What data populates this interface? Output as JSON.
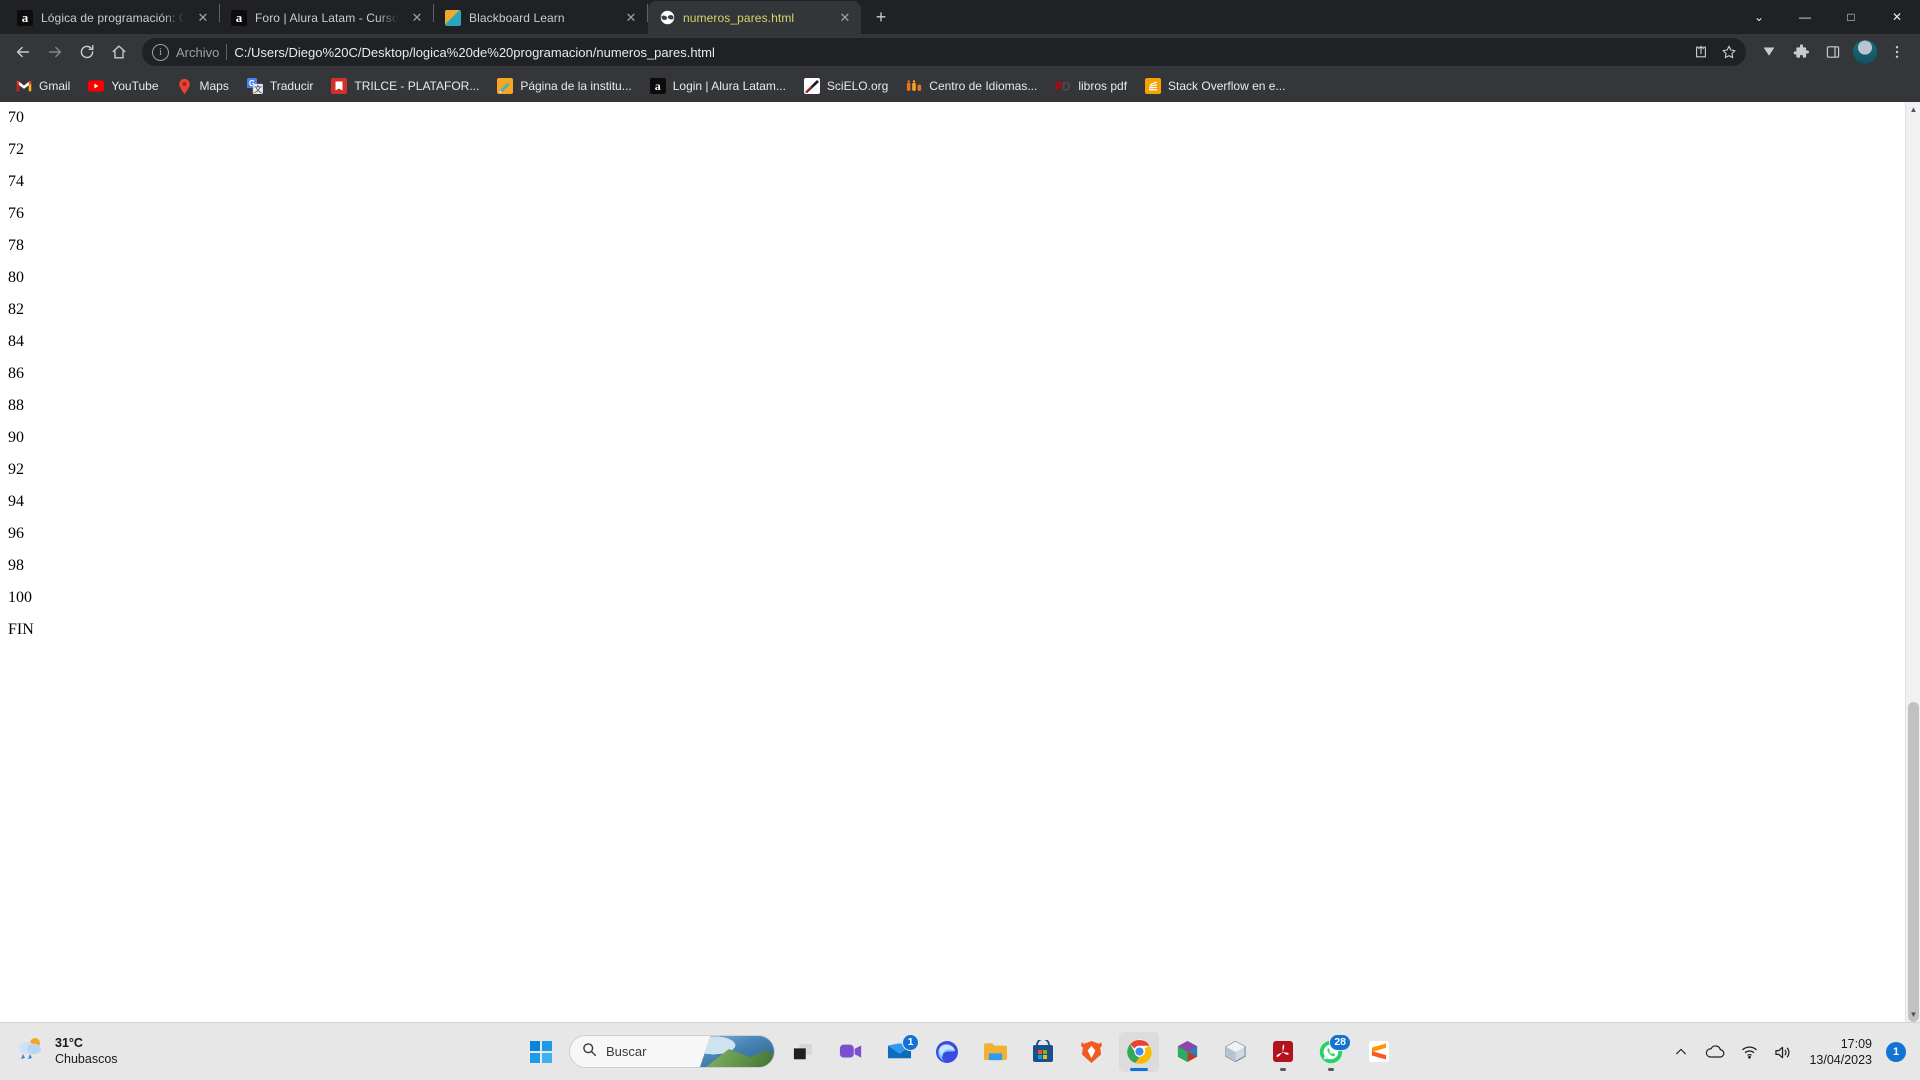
{
  "window": {
    "controls": {
      "minimize": "—",
      "maximize": "□",
      "close": "✕",
      "collapse": "⌄"
    }
  },
  "tabs": [
    {
      "title": "Lógica de programación: Concep",
      "icon": "alura-icon",
      "active": false,
      "close": "✕"
    },
    {
      "title": "Foro | Alura Latam - Cursos onlin",
      "icon": "alura-icon",
      "active": false,
      "close": "✕"
    },
    {
      "title": "Blackboard Learn",
      "icon": "blackboard-icon",
      "active": false,
      "close": "✕"
    },
    {
      "title": "numeros_pares.html",
      "icon": "globe-icon",
      "active": true,
      "close": "✕"
    }
  ],
  "newtab_label": "+",
  "toolbar": {
    "back_icon": "back-arrow-icon",
    "forward_icon": "forward-arrow-icon",
    "reload_icon": "reload-icon",
    "home_icon": "home-icon",
    "scheme_label": "Archivo",
    "url": "C:/Users/Diego%20C/Desktop/logica%20de%20programacion/numeros_pares.html",
    "share_icon": "share-icon",
    "bookmark_icon": "star-icon",
    "brave_icon": "downloads-icon",
    "extensions_icon": "puzzle-icon",
    "sidepanel_icon": "side-panel-icon",
    "profile_icon": "avatar",
    "menu_icon": "kebab-menu-icon"
  },
  "bookmarks": [
    {
      "label": "Gmail",
      "icon": "gmail-icon"
    },
    {
      "label": "YouTube",
      "icon": "youtube-icon"
    },
    {
      "label": "Maps",
      "icon": "maps-icon"
    },
    {
      "label": "Traducir",
      "icon": "translate-icon"
    },
    {
      "label": "TRILCE - PLATAFOR...",
      "icon": "trilce-icon"
    },
    {
      "label": "Página de la institu...",
      "icon": "institution-icon"
    },
    {
      "label": "Login | Alura Latam...",
      "icon": "alura-icon"
    },
    {
      "label": "SciELO.org",
      "icon": "scielo-icon"
    },
    {
      "label": "Centro de Idiomas...",
      "icon": "idiomas-icon"
    },
    {
      "label": "libros pdf",
      "icon": "pdf-folder-icon"
    },
    {
      "label": "Stack Overflow en e...",
      "icon": "stackoverflow-icon"
    }
  ],
  "page": {
    "lines": [
      "70",
      "72",
      "74",
      "76",
      "78",
      "80",
      "82",
      "84",
      "86",
      "88",
      "90",
      "92",
      "94",
      "96",
      "98",
      "100",
      "FIN"
    ]
  },
  "scrollbar": {
    "up": "▲",
    "down": "▼"
  },
  "taskbar": {
    "weather": {
      "temperature": "31°C",
      "description": "Chubascos",
      "icon": "rain-cloud-icon"
    },
    "start_icon": "windows-start-icon",
    "search": {
      "placeholder": "Buscar",
      "icon": "search-icon"
    },
    "apps": [
      {
        "name": "task-view-icon",
        "badge": null,
        "active": false,
        "running": false
      },
      {
        "name": "teams-icon",
        "badge": null,
        "active": false,
        "running": false
      },
      {
        "name": "mail-icon",
        "badge": "1",
        "active": false,
        "running": false
      },
      {
        "name": "edge-icon",
        "badge": null,
        "active": false,
        "running": false
      },
      {
        "name": "file-explorer-icon",
        "badge": null,
        "active": false,
        "running": false
      },
      {
        "name": "microsoft-store-icon",
        "badge": null,
        "active": false,
        "running": false
      },
      {
        "name": "brave-icon",
        "badge": null,
        "active": false,
        "running": false
      },
      {
        "name": "chrome-icon",
        "badge": null,
        "active": true,
        "running": true
      },
      {
        "name": "unity-hub-icon",
        "badge": null,
        "active": false,
        "running": false
      },
      {
        "name": "blender-icon",
        "badge": null,
        "active": false,
        "running": false
      },
      {
        "name": "acrobat-reader-icon",
        "badge": null,
        "active": false,
        "running": true
      },
      {
        "name": "whatsapp-icon",
        "badge": "28",
        "active": false,
        "running": true
      },
      {
        "name": "sublime-text-icon",
        "badge": null,
        "active": false,
        "running": false
      }
    ],
    "tray": {
      "chevron_icon": "show-hidden-icons-icon",
      "onedrive_icon": "onedrive-icon",
      "wifi_icon": "wifi-icon",
      "volume_icon": "volume-icon",
      "time": "17:09",
      "date": "13/04/2023",
      "notification_count": "1"
    }
  }
}
